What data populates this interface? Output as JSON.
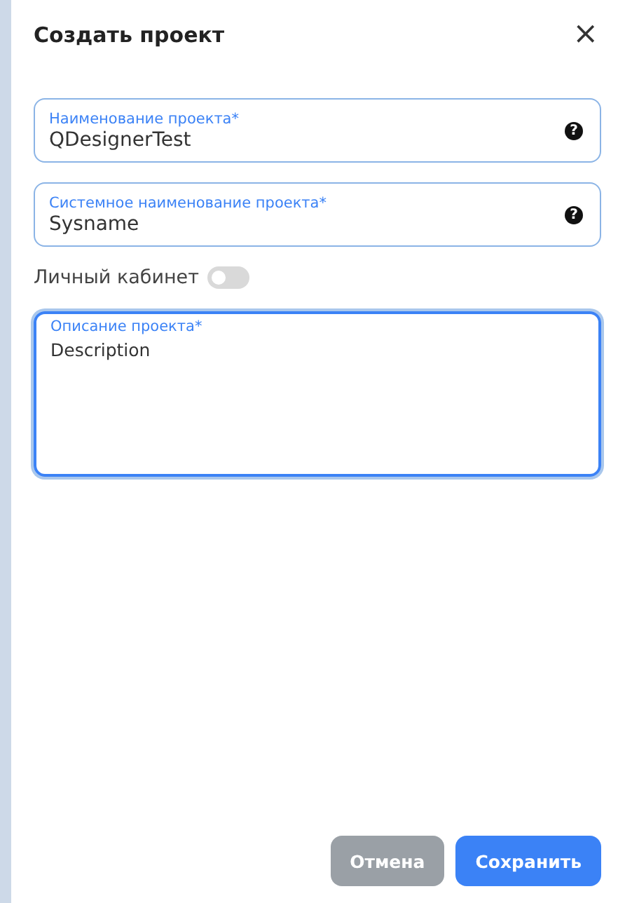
{
  "dialog": {
    "title": "Создать проект",
    "close": "×"
  },
  "fields": [
    {
      "kind": "input",
      "label": "Наименование проекта*",
      "value": "QDesignerTest",
      "help": "?",
      "focused": false
    },
    {
      "kind": "input",
      "label": "Системное наименование проекта*",
      "value": "Sysname",
      "help": "?",
      "focused": false
    }
  ],
  "toggle": {
    "label": "Личный кабинет",
    "on": false
  },
  "description": {
    "label": "Описание проекта*",
    "value": "Description",
    "focused": true
  },
  "buttons": [
    {
      "kind": "secondary",
      "label": "Отмена"
    },
    {
      "kind": "primary",
      "label": "Сохранить"
    }
  ]
}
